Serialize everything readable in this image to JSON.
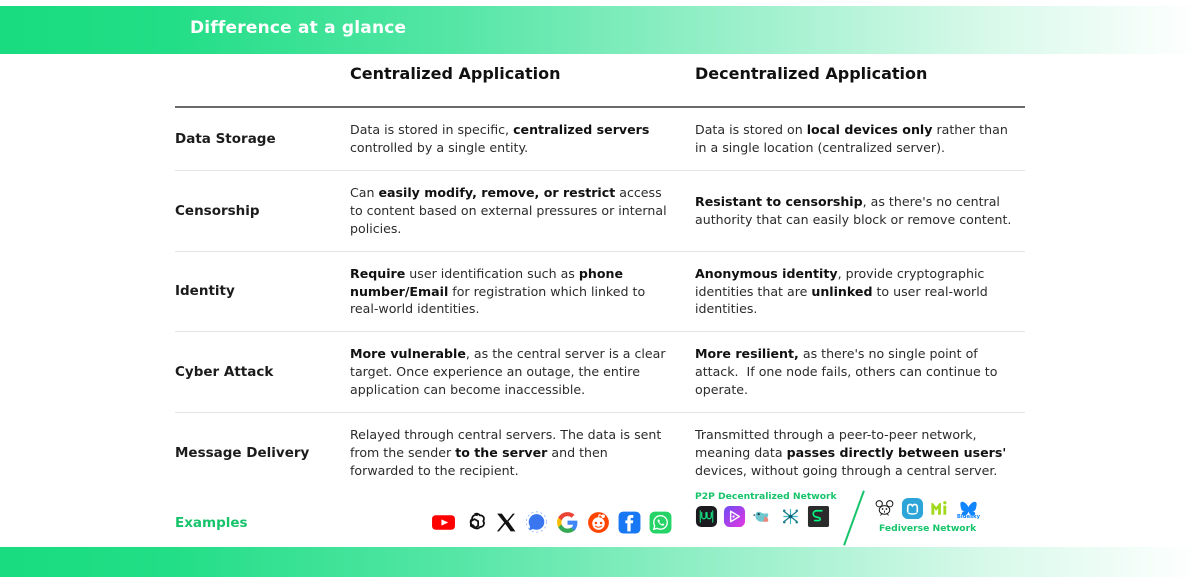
{
  "header": {
    "title": "Difference at a glance",
    "accent_color": "#18DC7F",
    "gradient_to": "#FFFFFF"
  },
  "table": {
    "columns": {
      "label": "",
      "centralized": "Centralized Application",
      "decentralized": "Decentralized Application"
    },
    "rows": [
      {
        "label": "Data Storage",
        "centralized_html": "Data is stored in specific, <b>centralized servers</b> controlled by a single entity.",
        "decentralized_html": "Data is stored on <b>local devices only</b> rather than in a single location (centralized server)."
      },
      {
        "label": "Censorship",
        "centralized_html": "Can <b>easily modify, remove, or restrict</b> access to content based on external pressures or internal policies.",
        "decentralized_html": "<b>Resistant to censorship</b>, as there's no central authority that can easily block or remove content."
      },
      {
        "label": "Identity",
        "centralized_html": "<b>Require</b> user identification such as <b>phone number/Email</b> for registration which linked to real-world identities.",
        "decentralized_html": "<b>Anonymous identity</b>, provide cryptographic identities that are <b>unlinked</b> to user real-world identities."
      },
      {
        "label": "Cyber Attack",
        "centralized_html": "<b>More vulnerable</b>, as the central server is a clear target. Once experience an outage, the entire application can become inaccessible.",
        "decentralized_html": "<b>More resilient,</b> as there's no single point of attack.&nbsp; If one node fails, others can continue to operate."
      },
      {
        "label": "Message Delivery",
        "centralized_html": "Relayed through central servers. The data is sent from the sender <b>to the server</b> and then forwarded to the recipient.",
        "decentralized_html": "Transmitted through a peer-to-peer network, meaning data <b>passes directly between users'</b> devices, without going through a central server."
      }
    ],
    "examples": {
      "label": "Examples",
      "label_color": "#17C46B",
      "centralized_logos": [
        {
          "name": "youtube-logo",
          "title": "YouTube"
        },
        {
          "name": "openai-logo",
          "title": "OpenAI"
        },
        {
          "name": "x-twitter-logo",
          "title": "X"
        },
        {
          "name": "signal-logo",
          "title": "Signal"
        },
        {
          "name": "google-logo",
          "title": "Google"
        },
        {
          "name": "reddit-logo",
          "title": "Reddit"
        },
        {
          "name": "facebook-logo",
          "title": "Facebook"
        },
        {
          "name": "whatsapp-logo",
          "title": "WhatsApp"
        }
      ],
      "p2p_group_title": "P2P Decentralized Network",
      "p2p_logos": [
        {
          "name": "wire-logo",
          "title": "Wire"
        },
        {
          "name": "delta-chat-logo",
          "title": "Delta Chat"
        },
        {
          "name": "bird-p2p-logo",
          "title": "Jami"
        },
        {
          "name": "briar-logo",
          "title": "Briar"
        },
        {
          "name": "session-logo",
          "title": "Session"
        }
      ],
      "fediverse_group_title": "Fediverse Network",
      "fediverse_logos": [
        {
          "name": "peertube-logo",
          "title": "PeerTube"
        },
        {
          "name": "mastodon-logo",
          "title": "Mastodon"
        },
        {
          "name": "misskey-logo",
          "title": "Misskey"
        },
        {
          "name": "bluesky-logo",
          "title": "Bluesky"
        }
      ]
    }
  }
}
